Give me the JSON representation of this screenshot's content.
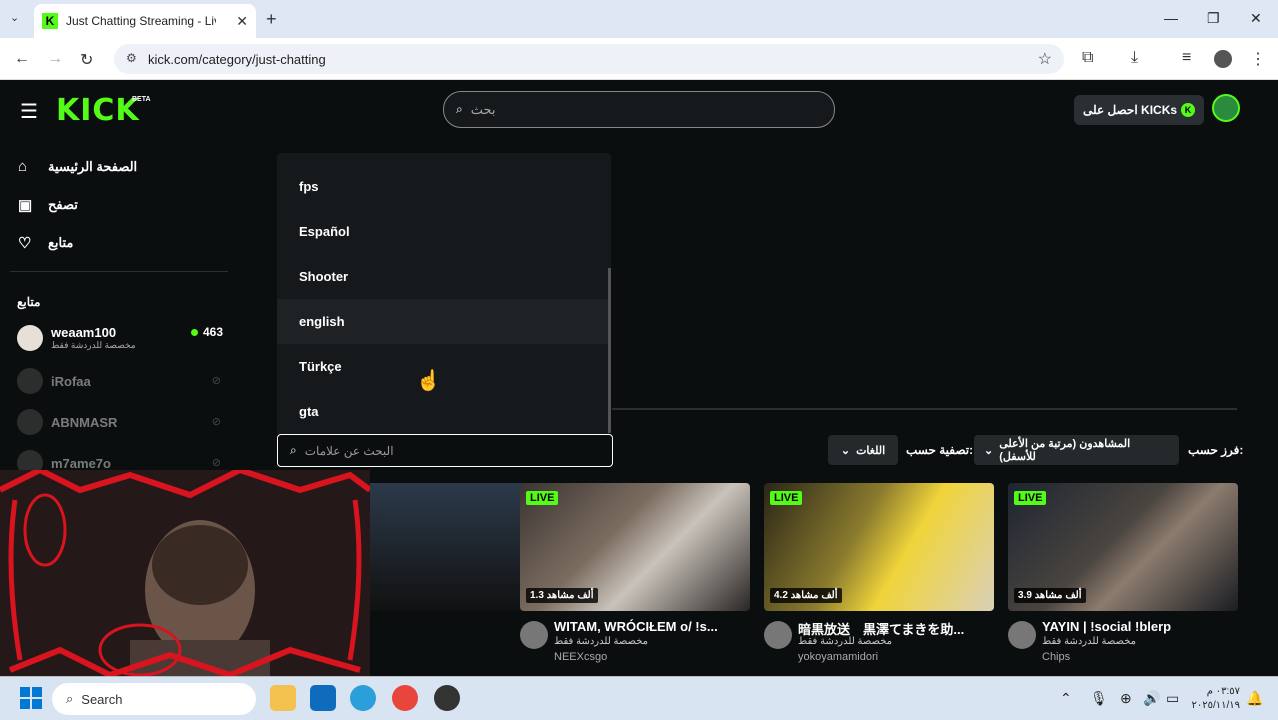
{
  "browser": {
    "tab_title": "Just Chatting Streaming - Live S",
    "url": "kick.com/category/just-chatting"
  },
  "header": {
    "logo": "KICK",
    "beta": "BETA",
    "search_placeholder": "بحث",
    "kicks_button": "احصل على KICKs",
    "kicks_icon": "K"
  },
  "sidebar": {
    "nav": [
      {
        "label": "الصفحة الرئيسية",
        "icon": "home-icon"
      },
      {
        "label": "تصفح",
        "icon": "browse-icon"
      },
      {
        "label": "متابع",
        "icon": "heart-icon"
      }
    ],
    "following_heading": "متابع",
    "channels": [
      {
        "name": "weaam100",
        "sub": "مخصصة للدردشة فقط",
        "viewers": "463",
        "live": true
      },
      {
        "name": "iRofaa",
        "live": false
      },
      {
        "name": "ABNMASR",
        "live": false
      },
      {
        "name": "m7ame7o",
        "live": false
      }
    ]
  },
  "tag_dropdown": {
    "options": [
      "fps",
      "Español",
      "Shooter",
      "english",
      "Türkçe",
      "gta"
    ],
    "highlighted": "english",
    "search_placeholder": "البحث عن علامات"
  },
  "filters": {
    "sort_label": "فرز حسب:",
    "sort_value": "المشاهدون (مرتبة من الأعلى للأسفل)",
    "filter_label": "تصفية حسب:",
    "filter_value": "اللغات"
  },
  "streams": [
    {
      "title": "WITAM, WRÓCIŁEM o/ !s...",
      "category": "مخصصة للدردشة فقط",
      "channel": "NEEXcsgo",
      "viewers": "1.3 ألف مشاهد",
      "live": "LIVE"
    },
    {
      "title": "暗黒放送　黒澤てまきを助...",
      "category": "مخصصة للدردشة فقط",
      "channel": "yokoyamamidori",
      "viewers": "4.2 ألف مشاهد",
      "live": "LIVE"
    },
    {
      "title": "YAYIN | !social !blerp",
      "category": "مخصصة للدردشة فقط",
      "channel": "Chips",
      "viewers": "3.9 ألف مشاهد",
      "live": "LIVE"
    }
  ],
  "taskbar": {
    "search": "Search",
    "time": "٠٣:٥٧ م",
    "date": "٢٠٢٥/١١/١٩"
  },
  "colors": {
    "accent": "#53fc18",
    "background": "#0b0e0f",
    "panel": "#16191b"
  }
}
